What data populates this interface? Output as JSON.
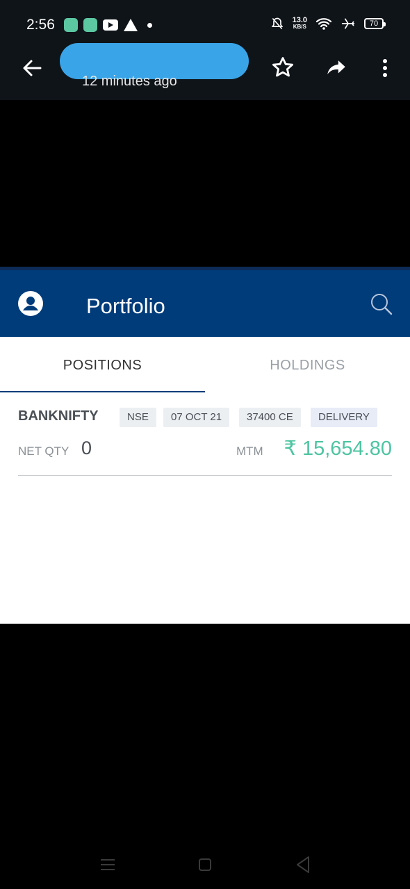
{
  "status_bar": {
    "time": "2:56",
    "net_speed": "13.0",
    "net_unit": "KB/S",
    "battery": "70",
    "app_icons": [
      "app-icon",
      "app-icon",
      "youtube-icon",
      "triangle-app-icon"
    ],
    "system_icons": [
      "bell-off-icon",
      "wifi-icon",
      "airplane-icon",
      "battery-icon"
    ]
  },
  "viewer": {
    "subtitle": "12 minutes ago",
    "actions": [
      "back-arrow-icon",
      "star-icon",
      "share-icon",
      "more-vert-icon"
    ]
  },
  "app": {
    "title": "Portfolio",
    "header_color": "#003b7a",
    "tabs": [
      {
        "label": "POSITIONS",
        "active": true
      },
      {
        "label": "HOLDINGS",
        "active": false
      }
    ]
  },
  "position": {
    "symbol": "BANKNIFTY",
    "exchange": "NSE",
    "expiry": "07 OCT 21",
    "strike": "37400 CE",
    "product": "DELIVERY",
    "net_qty_label": "NET QTY",
    "net_qty": "0",
    "mtm_label": "MTM",
    "mtm": "₹ 15,654.80",
    "mtm_color": "#4cc4a0"
  },
  "nav_bar": [
    "menu-icon",
    "home-icon",
    "back-triangle-icon"
  ]
}
